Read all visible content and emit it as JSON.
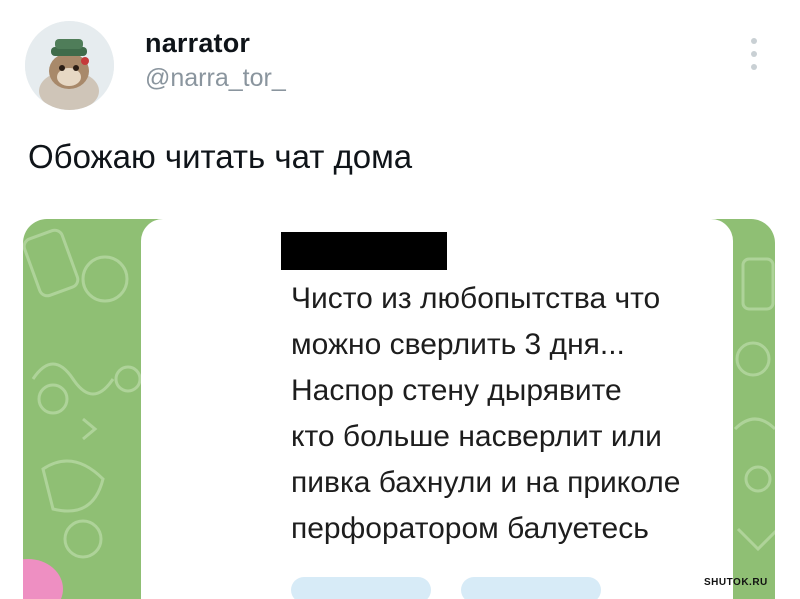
{
  "author": {
    "display_name": "narrator",
    "handle": "@narra_tor_"
  },
  "tweet": {
    "text": "Обожаю читать чат дома"
  },
  "screenshot": {
    "message_lines": [
      "Чисто из любопытства что",
      "можно сверлить 3 дня...",
      "Наспор стену дырявите",
      "кто больше насверлит или",
      "пивка бахнули и на приколе",
      "перфоратором балуетесь"
    ],
    "sender_redacted": true
  },
  "watermark": "SHUTOK.RU",
  "icons": {
    "more": "more-vertical-icon",
    "avatar": "cat-avatar"
  },
  "colors": {
    "chat_background": "#8fbf74",
    "bubble": "#ffffff",
    "text": "#0f1419",
    "muted": "#8a959e"
  }
}
